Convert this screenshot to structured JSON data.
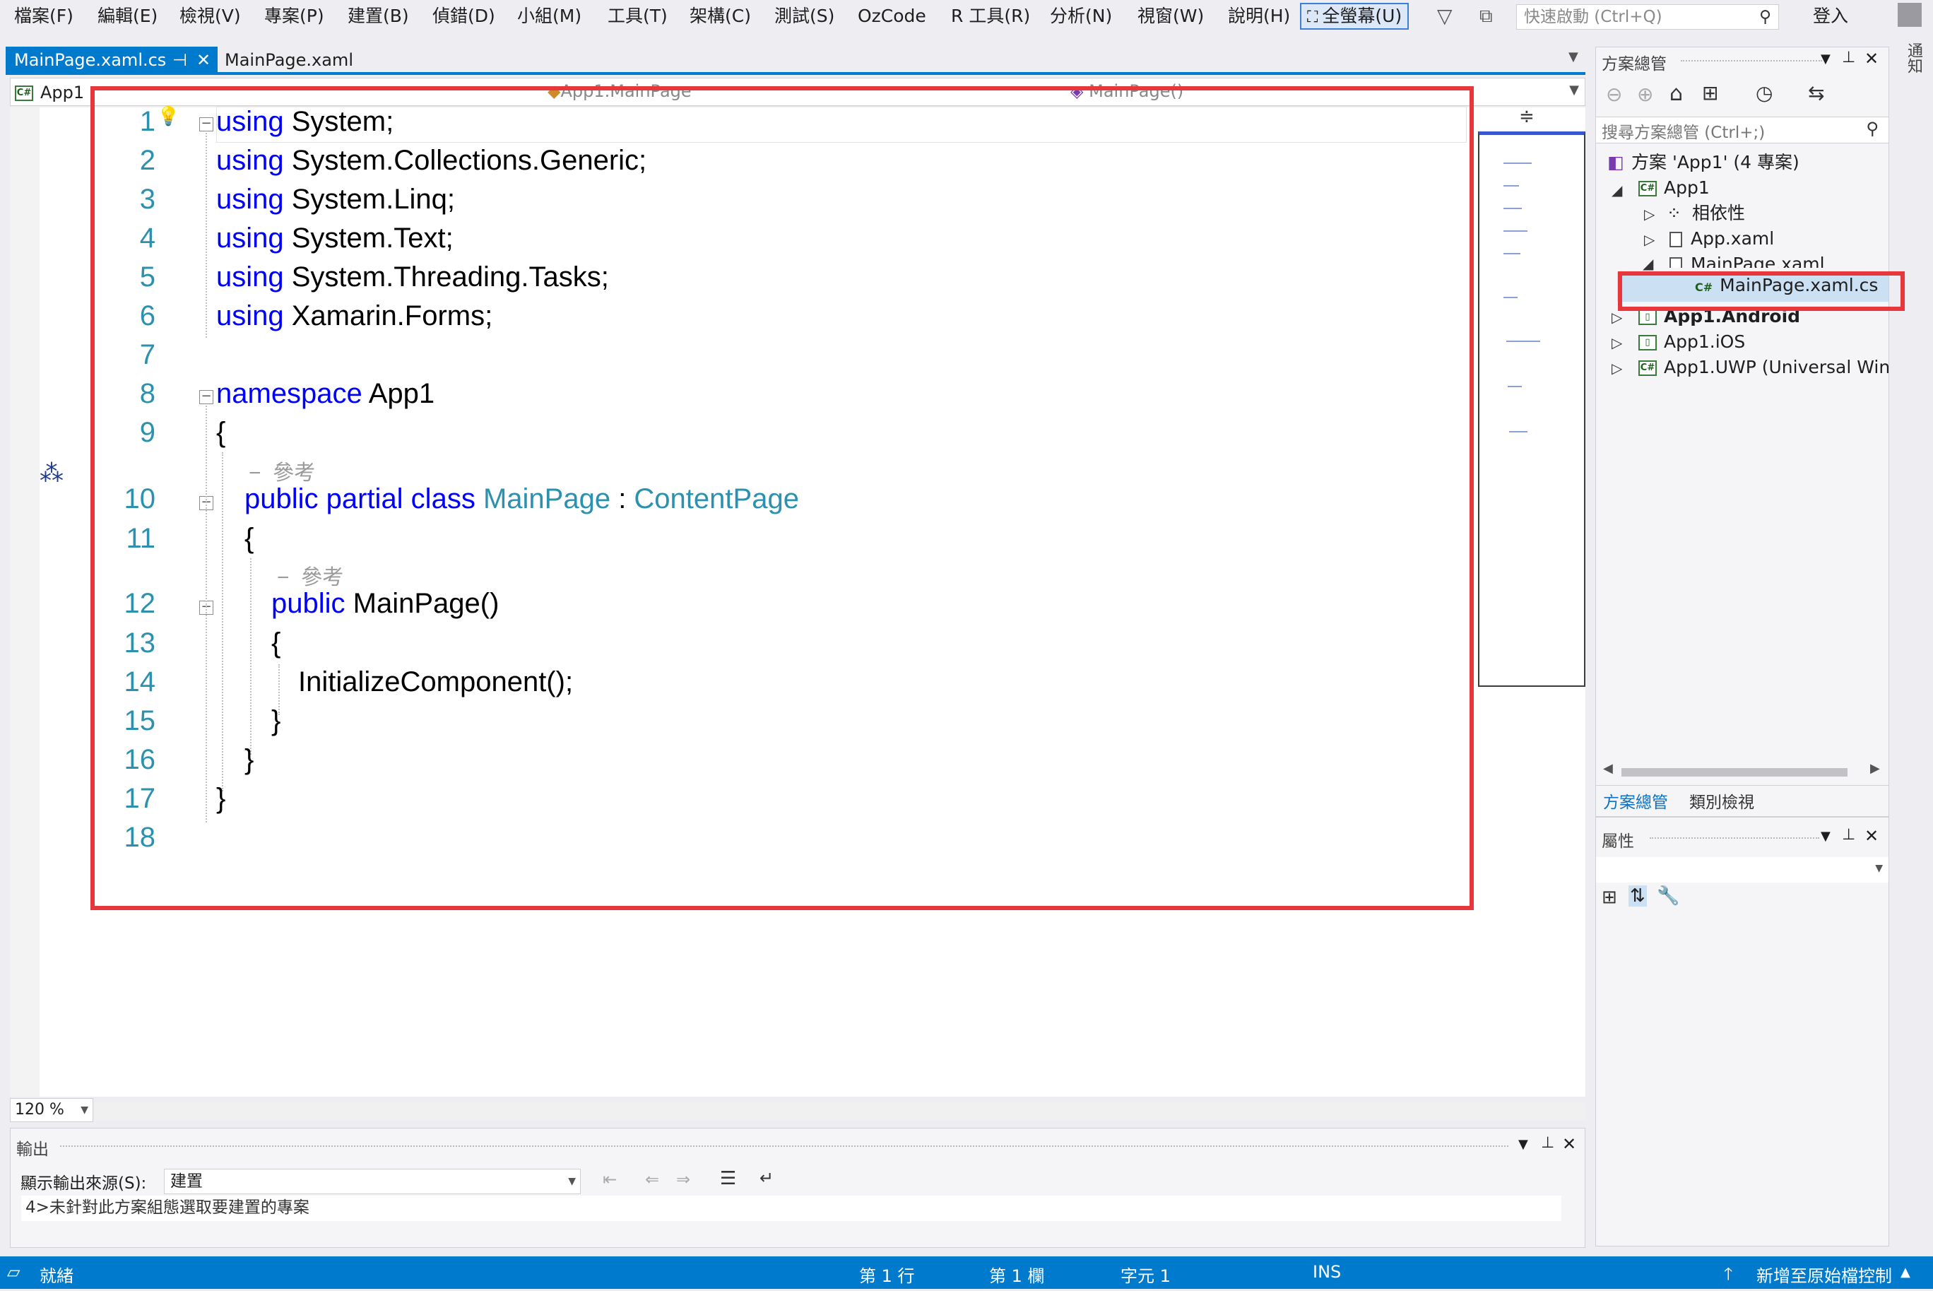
{
  "menu": {
    "items": [
      "檔案(F)",
      "編輯(E)",
      "檢視(V)",
      "專案(P)",
      "建置(B)",
      "偵錯(D)",
      "小組(M)",
      "工具(T)",
      "架構(C)",
      "測試(S)",
      "OzCode",
      "R 工具(R)",
      "分析(N)",
      "視窗(W)",
      "說明(H)"
    ],
    "fullscreen": "全螢幕(U)",
    "quick_launch_placeholder": "快速啟動 (Ctrl+Q)",
    "login": "登入"
  },
  "tabs": [
    {
      "label": "MainPage.xaml.cs",
      "active": true
    },
    {
      "label": "MainPage.xaml",
      "active": false
    }
  ],
  "navbar": {
    "project": "App1",
    "class": "App1.MainPage",
    "member": "MainPage()"
  },
  "editor": {
    "zoom": "120 %",
    "line_numbers": [
      "1",
      "2",
      "3",
      "4",
      "5",
      "6",
      "7",
      "8",
      "9",
      "10",
      "11",
      "12",
      "13",
      "14",
      "15",
      "16",
      "17",
      "18"
    ],
    "reference_hint": "參考",
    "lines": {
      "l1_kw": "using",
      "l1_rest": " System;",
      "l2_kw": "using",
      "l2_rest": " System.Collections.Generic;",
      "l3_kw": "using",
      "l3_rest": " System.Linq;",
      "l4_kw": "using",
      "l4_rest": " System.Text;",
      "l5_kw": "using",
      "l5_rest": " System.Threading.Tasks;",
      "l6_kw": "using",
      "l6_rest": " Xamarin.Forms;",
      "l8_kw": "namespace",
      "l8_rest": " App1",
      "l9": "{",
      "l10_kw": "public partial class",
      "l10_type1": "MainPage",
      "l10_sep": " : ",
      "l10_type2": "ContentPage",
      "l11": "{",
      "l12_kw": "public",
      "l12_rest": " MainPage()",
      "l13": "{",
      "l14": "InitializeComponent();",
      "l15": "}",
      "l16": "}",
      "l17": "}"
    }
  },
  "output": {
    "title": "輸出",
    "source_label": "顯示輸出來源(S):",
    "source_value": "建置",
    "text": "4>未針對此方案組態選取要建置的專案"
  },
  "solution": {
    "title": "方案總管",
    "search_placeholder": "搜尋方案總管 (Ctrl+;)",
    "root": "方案 'App1' (4 專案)",
    "items": {
      "app1": "App1",
      "deps": "相依性",
      "appxaml": "App.xaml",
      "mainxaml": "MainPage.xaml",
      "maincs": "MainPage.xaml.cs",
      "android": "App1.Android",
      "ios": "App1.iOS",
      "uwp": "App1.UWP (Universal Wind"
    },
    "bottom_tabs": [
      "方案總管",
      "類別檢視"
    ]
  },
  "properties": {
    "title": "屬性"
  },
  "notification_sidebar": "通知",
  "status": {
    "ready": "就緒",
    "line": "第 1 行",
    "col": "第 1 欄",
    "char": "字元 1",
    "ins": "INS",
    "source_control": "新增至原始檔控制"
  },
  "colors": {
    "statusbar": "#007acc",
    "keyword": "#0000ff",
    "type": "#2b91af",
    "highlight": "#e8373c"
  }
}
